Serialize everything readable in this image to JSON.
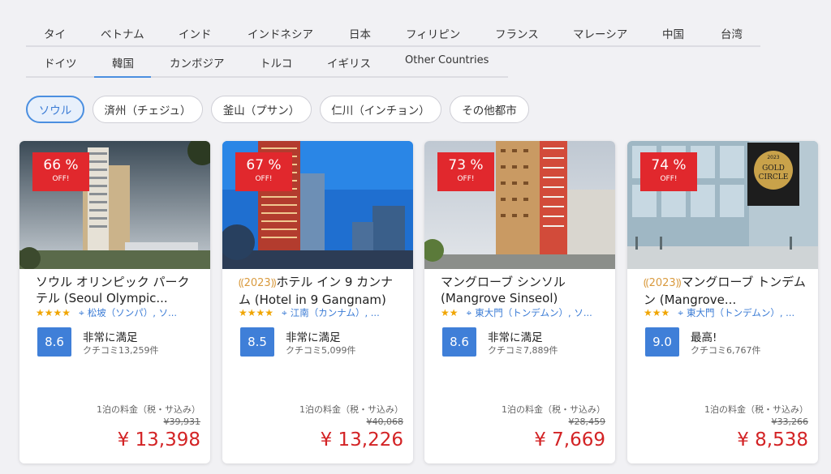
{
  "country_tabs_row1": [
    "タイ",
    "ベトナム",
    "インド",
    "インドネシア",
    "日本",
    "フィリピン",
    "フランス",
    "マレーシア",
    "中国",
    "台湾"
  ],
  "country_tabs_row2": [
    "ドイツ",
    "韓国",
    "カンボジア",
    "トルコ",
    "イギリス",
    "Other Countries"
  ],
  "active_country": "韓国",
  "city_chips": [
    "ソウル",
    "済州（チェジュ）",
    "釜山（プサン）",
    "仁川（インチョン）",
    "その他都市"
  ],
  "active_city": "ソウル",
  "colors": {
    "accent": "#4b8fe0",
    "discount_red": "#e1282d",
    "price_red": "#d32325",
    "score_blue": "#3f7fd8",
    "star": "#f0a500"
  },
  "cards": [
    {
      "discount": "66 %",
      "off": "OFF!",
      "year": "",
      "name": "ソウル オリンピック パークテル (Seoul Olympic...",
      "stars": "★★★★",
      "location": "松坡（ソンパ）, ソ...",
      "score": "8.6",
      "rating_label": "非常に満足",
      "reviews": "クチコミ13,259件",
      "price_label": "1泊の料金（税・サ込み）",
      "original_price": "¥39,931",
      "price": "¥ 13,398"
    },
    {
      "discount": "67 %",
      "off": "OFF!",
      "year": "2023",
      "name": "ホテル イン 9 カンナム (Hotel in 9 Gangnam)",
      "stars": "★★★★",
      "location": "江南（カンナム）, ...",
      "score": "8.5",
      "rating_label": "非常に満足",
      "reviews": "クチコミ5,099件",
      "price_label": "1泊の料金（税・サ込み）",
      "original_price": "¥40,068",
      "price": "¥ 13,226"
    },
    {
      "discount": "73 %",
      "off": "OFF!",
      "year": "",
      "name": "マングローブ シンソル (Mangrove Sinseol)",
      "stars": "★★",
      "location": "東大門（トンデムン）, ソ...",
      "score": "8.6",
      "rating_label": "非常に満足",
      "reviews": "クチコミ7,889件",
      "price_label": "1泊の料金（税・サ込み）",
      "original_price": "¥28,459",
      "price": "¥ 7,669"
    },
    {
      "discount": "74 %",
      "off": "OFF!",
      "year": "2023",
      "name": "マングローブ トンデムン (Mangrove...",
      "stars": "★★★",
      "location": "東大門（トンデムン）, ...",
      "score": "9.0",
      "rating_label": "最高!",
      "reviews": "クチコミ6,767件",
      "price_label": "1泊の料金（税・サ込み）",
      "original_price": "¥33,266",
      "price": "¥ 8,538",
      "photo_sign": [
        "2023",
        "GOLD",
        "CIRCLE"
      ]
    }
  ]
}
